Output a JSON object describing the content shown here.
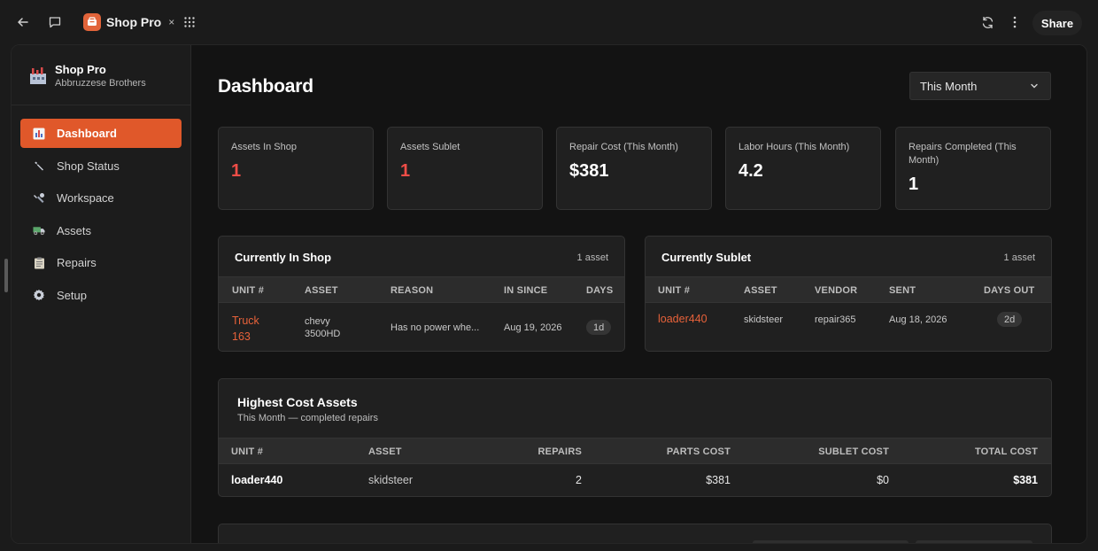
{
  "topbar": {
    "app_tab_name": "Shop Pro",
    "tab_close": "×",
    "share_label": "Share"
  },
  "brand": {
    "name": "Shop Pro",
    "subtitle": "Abbruzzese Brothers"
  },
  "sidebar": {
    "items": [
      {
        "label": "Dashboard",
        "icon": "bar-chart-icon",
        "active": true
      },
      {
        "label": "Shop Status",
        "icon": "wrench-icon",
        "active": false
      },
      {
        "label": "Workspace",
        "icon": "tools-icon",
        "active": false
      },
      {
        "label": "Assets",
        "icon": "truck-icon",
        "active": false
      },
      {
        "label": "Repairs",
        "icon": "clipboard-icon",
        "active": false
      },
      {
        "label": "Setup",
        "icon": "gear-icon",
        "active": false
      }
    ]
  },
  "main": {
    "title": "Dashboard",
    "period_select": "This Month",
    "stats": [
      {
        "label": "Assets In Shop",
        "value": "1",
        "alert": true
      },
      {
        "label": "Assets Sublet",
        "value": "1",
        "alert": true
      },
      {
        "label": "Repair Cost (This Month)",
        "value": "$381",
        "alert": false
      },
      {
        "label": "Labor Hours (This Month)",
        "value": "4.2",
        "alert": false
      },
      {
        "label": "Repairs Completed (This Month)",
        "value": "1",
        "alert": false
      }
    ]
  },
  "in_shop": {
    "title": "Currently In Shop",
    "count": "1 asset",
    "headers": [
      "UNIT #",
      "ASSET",
      "REASON",
      "IN SINCE",
      "DAYS"
    ],
    "rows": [
      {
        "unit_line1": "Truck",
        "unit_line2": "163",
        "asset_line1": "chevy",
        "asset_line2": "3500HD",
        "reason": "Has no power whe...",
        "in_since": "Aug 19, 2026",
        "days": "1d"
      }
    ]
  },
  "sublet": {
    "title": "Currently Sublet",
    "count": "1 asset",
    "headers": [
      "UNIT #",
      "ASSET",
      "VENDOR",
      "SENT",
      "DAYS OUT"
    ],
    "rows": [
      {
        "unit": "loader440",
        "asset": "skidsteer",
        "vendor": "repair365",
        "sent": "Aug 18, 2026",
        "days_out": "2d"
      }
    ]
  },
  "highest_cost": {
    "title": "Highest Cost Assets",
    "subtitle": "This Month — completed repairs",
    "headers": [
      "UNIT #",
      "ASSET",
      "REPAIRS",
      "PARTS COST",
      "SUBLET COST",
      "TOTAL COST"
    ],
    "rows": [
      {
        "unit": "loader440",
        "asset": "skidsteer",
        "repairs": "2",
        "parts_cost": "$381",
        "sublet_cost": "$0",
        "total_cost": "$381"
      }
    ]
  },
  "colors": {
    "accent": "#e0582a",
    "alert_red": "#ef4d47",
    "link": "#e8623a"
  }
}
